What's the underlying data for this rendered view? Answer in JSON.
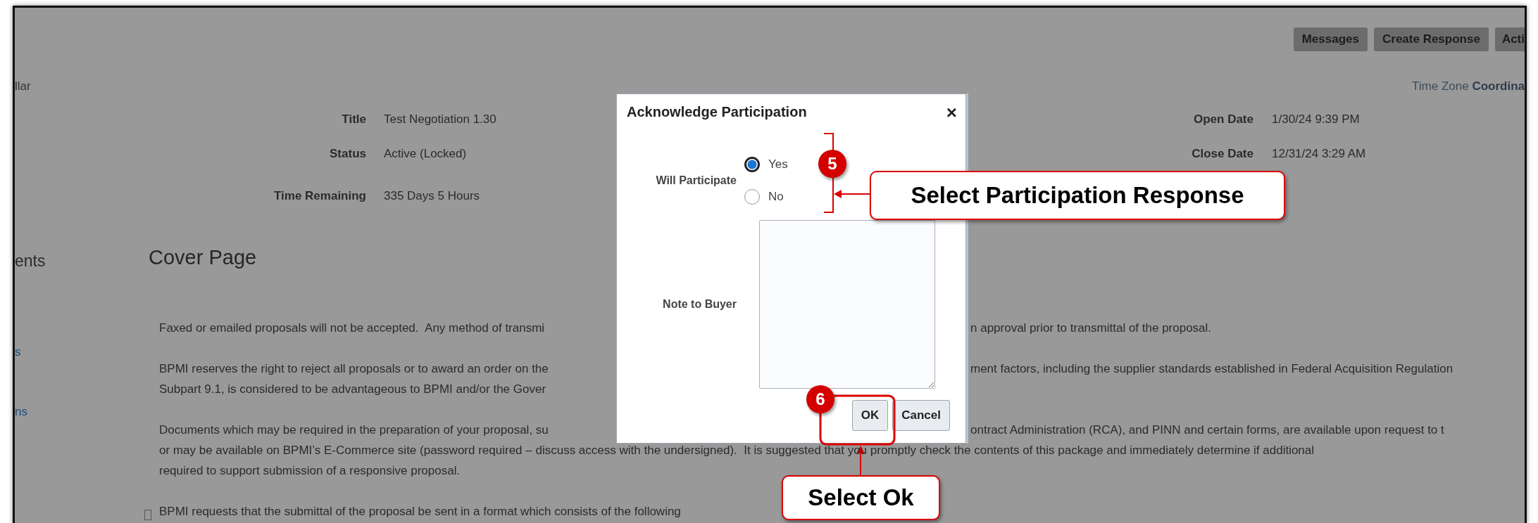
{
  "header_buttons": [
    {
      "label": "Messages"
    },
    {
      "label": "Create Response"
    },
    {
      "label": "Acti"
    }
  ],
  "sidebar": {
    "top_text": "llar",
    "heading": "ents",
    "links": [
      "s",
      "ns"
    ]
  },
  "time_zone": {
    "label": "Time Zone",
    "value": "Coordina"
  },
  "details_left": [
    {
      "label": "Title",
      "value": "Test Negotiation 1.30"
    },
    {
      "label": "Status",
      "value": "Active (Locked)"
    },
    {
      "label": "Time Remaining",
      "value": "335 Days 5 Hours"
    }
  ],
  "details_right": [
    {
      "label": "Open Date",
      "value": "1/30/24 9:39 PM"
    },
    {
      "label": "Close Date",
      "value": "12/31/24 3:29 AM"
    }
  ],
  "cover_page": {
    "title": "Cover Page",
    "paragraphs": [
      {
        "bullet": false,
        "lines": [
          {
            "left": "Faxed or emailed proposals will not be accepted.  Any method of transmi",
            "right": "n approval prior to transmittal of the proposal."
          }
        ]
      },
      {
        "bullet": false,
        "lines": [
          {
            "left": "BPMI reserves the right to reject all proposals or to award an order on the",
            "right": "ment factors, including the supplier standards established in Federal Acquisition Regulation"
          },
          {
            "left": "Subpart 9.1, is considered to be advantageous to BPMI and/or the Gover"
          }
        ]
      },
      {
        "bullet": false,
        "lines": [
          {
            "left": "Documents which may be required in the preparation of your proposal, su",
            "right": "ontract Administration (RCA), and PINN and certain forms, are available upon request to t"
          },
          {
            "left": "or may be available on BPMI’s E-Commerce site (password required – discuss access with the undersigned).  It is suggested that you promptly check the contents of this package and immediately determine if additional"
          },
          {
            "left": "required to support submission of a responsive proposal."
          }
        ]
      },
      {
        "bullet": true,
        "lines": [
          {
            "left": "BPMI requests that the submittal of the proposal be sent in a format which consists of the following"
          }
        ]
      }
    ]
  },
  "dialog": {
    "title": "Acknowledge Participation",
    "close": "×",
    "participate_label": "Will Participate",
    "options": [
      {
        "label": "Yes",
        "selected": true
      },
      {
        "label": "No",
        "selected": false
      }
    ],
    "note_label": "Note to Buyer",
    "buttons": [
      {
        "label": "OK"
      },
      {
        "label": "Cancel"
      }
    ]
  },
  "callouts": [
    {
      "number": "5",
      "text": "Select Participation Response"
    },
    {
      "number": "6",
      "text": "Select Ok"
    }
  ]
}
